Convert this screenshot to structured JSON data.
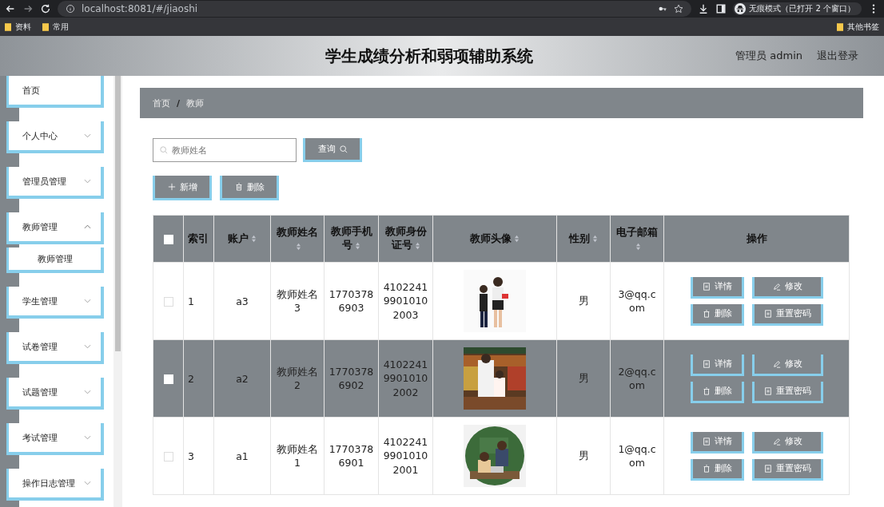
{
  "browser": {
    "url": "localhost:8081/#/jiaoshi",
    "incognito_label": "无痕模式（已打开 2 个窗口）",
    "bookmarks": [
      "资料",
      "常用"
    ],
    "other_bookmarks": "其他书签"
  },
  "header": {
    "title": "学生成绩分析和弱项辅助系统",
    "user": "管理员 admin",
    "logout": "退出登录"
  },
  "sidebar": {
    "items": [
      {
        "label": "首页",
        "kind": "link"
      },
      {
        "label": "个人中心",
        "kind": "menu",
        "expanded": false
      },
      {
        "label": "管理员管理",
        "kind": "menu",
        "expanded": false
      },
      {
        "label": "教师管理",
        "kind": "menu",
        "expanded": true,
        "children": [
          {
            "label": "教师管理"
          }
        ]
      },
      {
        "label": "学生管理",
        "kind": "menu",
        "expanded": false
      },
      {
        "label": "试卷管理",
        "kind": "menu",
        "expanded": false
      },
      {
        "label": "试题管理",
        "kind": "menu",
        "expanded": false
      },
      {
        "label": "考试管理",
        "kind": "menu",
        "expanded": false
      },
      {
        "label": "操作日志管理",
        "kind": "menu",
        "expanded": false
      }
    ]
  },
  "breadcrumb": {
    "items": [
      "首页",
      "教师"
    ],
    "separator": "/"
  },
  "search": {
    "placeholder": "教师姓名",
    "button": "查询"
  },
  "toolbar": [
    {
      "label": "新增",
      "kind": "add"
    },
    {
      "label": "删除",
      "kind": "delete"
    }
  ],
  "table": {
    "all_checked": false,
    "columns": [
      {
        "kind": "checkbox",
        "sortable": false
      },
      {
        "label": "索引",
        "sortable": false
      },
      {
        "label": "账户",
        "sortable": true
      },
      {
        "label": "教师姓名",
        "sortable": true
      },
      {
        "label": "教师手机号",
        "sortable": true
      },
      {
        "label": "教师身份证号",
        "sortable": true
      },
      {
        "label": "教师头像",
        "sortable": true
      },
      {
        "label": "性别",
        "sortable": true
      },
      {
        "label": "电子邮箱",
        "sortable": true
      },
      {
        "label": "操作",
        "sortable": false
      }
    ],
    "rows": [
      {
        "selected": false,
        "checked": false,
        "index": "1",
        "account": "a3",
        "name": "教师姓名3",
        "phone": "17703786903",
        "id_number": "410224199010102003",
        "gender": "男",
        "email": "3@qq.com",
        "actions": [
          {
            "label": "详情",
            "kind": "detail"
          },
          {
            "label": "修改",
            "kind": "edit"
          },
          {
            "label": "删除",
            "kind": "delete"
          },
          {
            "label": "重置密码",
            "kind": "reset"
          }
        ]
      },
      {
        "selected": true,
        "checked": false,
        "index": "2",
        "account": "a2",
        "name": "教师姓名2",
        "phone": "17703786902",
        "id_number": "410224199010102002",
        "gender": "男",
        "email": "2@qq.com",
        "actions": [
          {
            "label": "详情",
            "kind": "detail"
          },
          {
            "label": "修改",
            "kind": "edit"
          },
          {
            "label": "删除",
            "kind": "delete"
          },
          {
            "label": "重置密码",
            "kind": "reset"
          }
        ]
      },
      {
        "selected": false,
        "checked": false,
        "index": "3",
        "account": "a1",
        "name": "教师姓名1",
        "phone": "17703786901",
        "id_number": "410224199010102001",
        "gender": "男",
        "email": "1@qq.com",
        "actions": [
          {
            "label": "详情",
            "kind": "detail"
          },
          {
            "label": "修改",
            "kind": "edit"
          },
          {
            "label": "删除",
            "kind": "delete"
          },
          {
            "label": "重置密码",
            "kind": "reset"
          }
        ]
      }
    ]
  }
}
